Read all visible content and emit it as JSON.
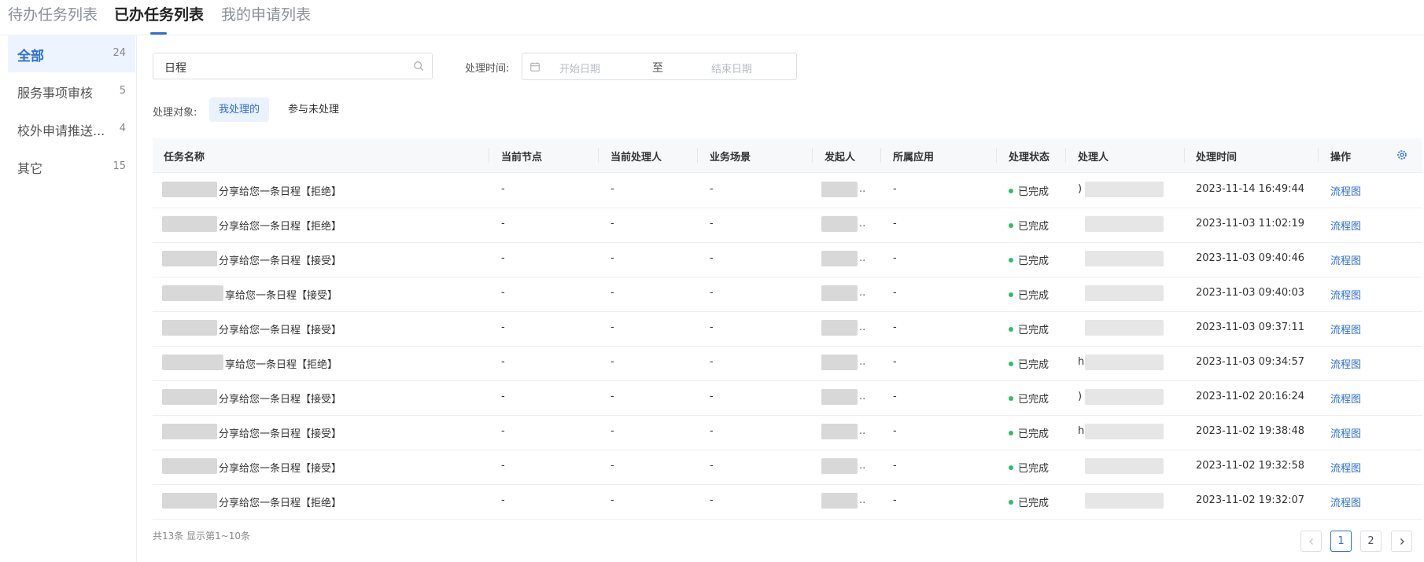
{
  "tabs": [
    "待办任务列表",
    "已办任务列表",
    "我的申请列表"
  ],
  "active_tab": 1,
  "categories": [
    {
      "label": "全部",
      "count": "24"
    },
    {
      "label": "服务事项审核",
      "count": "5"
    },
    {
      "label": "校外申请推送...",
      "count": "4"
    },
    {
      "label": "其它",
      "count": "15"
    }
  ],
  "filters": {
    "search_value": "日程",
    "time_label": "处理时间:",
    "start_placeholder": "开始日期",
    "range_sep": "至",
    "end_placeholder": "结束日期",
    "target_label": "处理对象:",
    "target_options": [
      "我处理的",
      "参与未处理"
    ]
  },
  "table": {
    "columns": [
      "任务名称",
      "当前节点",
      "当前处理人",
      "业务场景",
      "发起人",
      "所属应用",
      "处理状态",
      "处理人",
      "处理时间",
      "操作"
    ],
    "rows": [
      {
        "name": "分享给您一条日程【拒绝】",
        "node": "-",
        "cur_handler": "-",
        "scene": "-",
        "initiator": "..",
        "app": "-",
        "status": "已完成",
        "handler": ")",
        "time": "2023-11-14 16:49:44",
        "action": "流程图"
      },
      {
        "name": "分享给您一条日程【拒绝】",
        "node": "-",
        "cur_handler": "-",
        "scene": "-",
        "initiator": "..",
        "app": "-",
        "status": "已完成",
        "handler": "",
        "time": "2023-11-03 11:02:19",
        "action": "流程图"
      },
      {
        "name": "分享给您一条日程【接受】",
        "node": "-",
        "cur_handler": "-",
        "scene": "-",
        "initiator": "..",
        "app": "-",
        "status": "已完成",
        "handler": "",
        "time": "2023-11-03 09:40:46",
        "action": "流程图"
      },
      {
        "name": "享给您一条日程【接受】",
        "node": "-",
        "cur_handler": "-",
        "scene": "-",
        "initiator": "..",
        "app": "-",
        "status": "已完成",
        "handler": "",
        "time": "2023-11-03 09:40:03",
        "action": "流程图"
      },
      {
        "name": "分享给您一条日程【接受】",
        "node": "-",
        "cur_handler": "-",
        "scene": "-",
        "initiator": "..",
        "app": "-",
        "status": "已完成",
        "handler": "",
        "time": "2023-11-03 09:37:11",
        "action": "流程图"
      },
      {
        "name": "享给您一条日程【拒绝】",
        "node": "-",
        "cur_handler": "-",
        "scene": "-",
        "initiator": "..",
        "app": "-",
        "status": "已完成",
        "handler": "h",
        "time": "2023-11-03 09:34:57",
        "action": "流程图"
      },
      {
        "name": "分享给您一条日程【接受】",
        "node": "-",
        "cur_handler": "-",
        "scene": "-",
        "initiator": "..",
        "app": "-",
        "status": "已完成",
        "handler": ")",
        "time": "2023-11-02 20:16:24",
        "action": "流程图"
      },
      {
        "name": "分享给您一条日程【接受】",
        "node": "-",
        "cur_handler": "-",
        "scene": "-",
        "initiator": "..",
        "app": "-",
        "status": "已完成",
        "handler": "h",
        "time": "2023-11-02 19:38:48",
        "action": "流程图"
      },
      {
        "name": "分享给您一条日程【接受】",
        "node": "-",
        "cur_handler": "-",
        "scene": "-",
        "initiator": "..",
        "app": "-",
        "status": "已完成",
        "handler": "",
        "time": "2023-11-02 19:32:58",
        "action": "流程图"
      },
      {
        "name": "分享给您一条日程【拒绝】",
        "node": "-",
        "cur_handler": "-",
        "scene": "-",
        "initiator": "..",
        "app": "-",
        "status": "已完成",
        "handler": "",
        "time": "2023-11-02 19:32:07",
        "action": "流程图"
      }
    ]
  },
  "footer": {
    "total": "共13条 显示第1~10条",
    "pages": [
      "1",
      "2"
    ],
    "current_page": 1
  },
  "colors": {
    "accent": "#2d6fd8",
    "status_done": "#2bbf6a"
  }
}
